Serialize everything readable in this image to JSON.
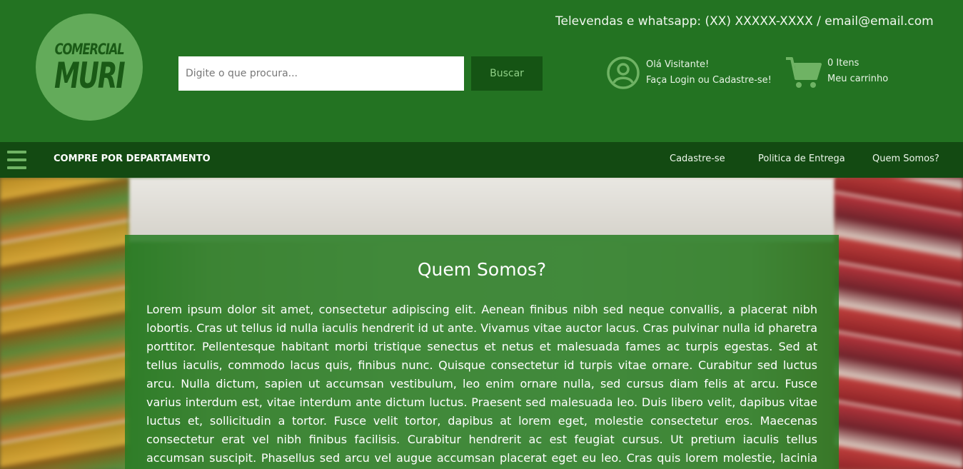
{
  "header": {
    "logo": {
      "line1": "COMERCIAL",
      "line2": "MURI"
    },
    "contact": "Televendas e whatsapp: (XX) XXXXX-XXXX / email@email.com",
    "search": {
      "placeholder": "Digite o que procura...",
      "button": "Buscar"
    },
    "user": {
      "greeting": "Olá Visitante!",
      "login": "Faça Login ou Cadastre-se!"
    },
    "cart": {
      "items": "0 Itens",
      "label": "Meu carrinho"
    }
  },
  "nav": {
    "department": "COMPRE POR DEPARTAMENTO",
    "links": [
      "Cadastre-se",
      "Politica de Entrega",
      "Quem Somos?"
    ]
  },
  "content": {
    "title": "Quem Somos?",
    "body": "Lorem ipsum dolor sit amet, consectetur adipiscing elit. Aenean finibus nibh sed neque convallis, a placerat nibh lobortis. Cras ut tellus id nulla iaculis hendrerit id ut ante. Vivamus vitae auctor lacus. Cras pulvinar nulla id pharetra porttitor. Pellentesque habitant morbi tristique senectus et netus et malesuada fames ac turpis egestas. Sed at tellus iaculis, commodo lacus quis, finibus nunc. Quisque consectetur id turpis vitae ornare. Curabitur sed luctus arcu. Nulla dictum, sapien ut accumsan vestibulum, leo enim ornare nulla, sed cursus diam felis at arcu. Fusce varius interdum est, vitae interdum ante dictum luctus. Praesent sed malesuada leo. Duis libero velit, dapibus vitae luctus et, sollicitudin a tortor. Fusce velit tortor, dapibus at lorem eget, molestie consectetur eros. Maecenas consectetur erat vel nibh finibus facilisis. Curabitur hendrerit ac est feugiat cursus. Ut pretium iaculis tellus accumsan suscipit. Phasellus sed arcu vel augue accumsan placerat eget eu leo. Cras quis lorem molestie, lacinia quam nec,"
  },
  "colors": {
    "header_bg": "#237322",
    "nav_bg": "#134a12",
    "logo_bg": "#63ab5a",
    "accent_icon": "#6fb364",
    "search_button_bg": "#155414"
  },
  "icons": [
    "user-icon",
    "cart-icon",
    "hamburger-icon"
  ]
}
